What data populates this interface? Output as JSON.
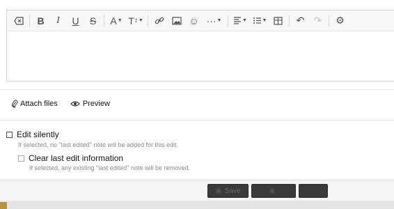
{
  "toolbar": {
    "buttons": [
      {
        "name": "remove-formatting-icon",
        "glyph": "⌫"
      },
      {
        "name": "bold-icon",
        "glyph": "B"
      },
      {
        "name": "italic-icon",
        "glyph": "I"
      },
      {
        "name": "underline-icon",
        "glyph": "U"
      },
      {
        "name": "strikethrough-icon",
        "glyph": "S"
      },
      {
        "name": "text-color-icon",
        "glyph": "A"
      },
      {
        "name": "font-size-icon",
        "glyph": "T↕"
      },
      {
        "name": "link-icon",
        "glyph": "🔗"
      },
      {
        "name": "image-icon",
        "glyph": "▣"
      },
      {
        "name": "emoji-icon",
        "glyph": "☺"
      },
      {
        "name": "more-options-icon",
        "glyph": "···"
      },
      {
        "name": "align-icon",
        "glyph": "≡"
      },
      {
        "name": "list-icon",
        "glyph": "☰"
      },
      {
        "name": "table-icon",
        "glyph": "⊞"
      },
      {
        "name": "undo-icon",
        "glyph": "↶"
      },
      {
        "name": "redo-icon",
        "glyph": "↷"
      },
      {
        "name": "settings-icon",
        "glyph": "⚙"
      }
    ]
  },
  "attach": {
    "attach_label": "Attach files",
    "preview_label": "Preview"
  },
  "options": {
    "edit_silently_label": "Edit silently",
    "edit_silently_hint": "If selected, no \"last edited\" note will be added for this edit.",
    "clear_last_edit_label": "Clear last edit information",
    "clear_last_edit_hint": "If selected, any existing \"last edited\" note will be removed."
  },
  "footer": {
    "save_label": "Save",
    "button2_label": "",
    "button3_label": ""
  }
}
